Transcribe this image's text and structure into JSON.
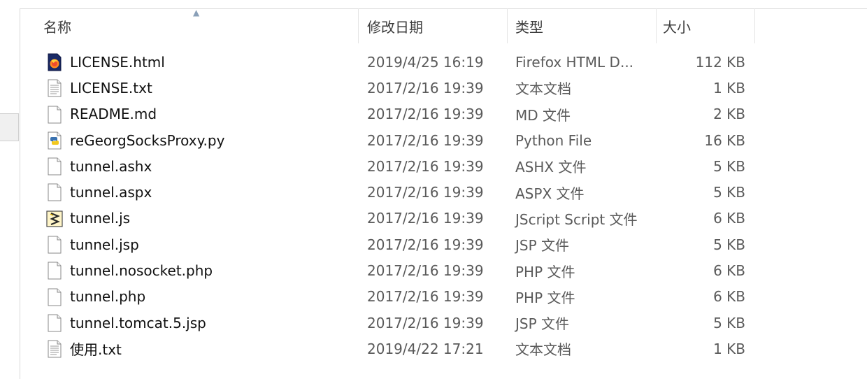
{
  "columns": {
    "name": "名称",
    "date": "修改日期",
    "type": "类型",
    "size": "大小"
  },
  "icons": {
    "html": "firefox-html-file-icon",
    "text": "text-document-icon",
    "blank": "generic-file-icon",
    "python": "python-file-icon",
    "js": "jscript-file-icon"
  },
  "files": [
    {
      "name": "LICENSE.html",
      "date": "2019/4/25 16:19",
      "type": "Firefox HTML D...",
      "size": "112 KB",
      "icon": "html"
    },
    {
      "name": "LICENSE.txt",
      "date": "2017/2/16 19:39",
      "type": "文本文档",
      "size": "1 KB",
      "icon": "text"
    },
    {
      "name": "README.md",
      "date": "2017/2/16 19:39",
      "type": "MD 文件",
      "size": "2 KB",
      "icon": "blank"
    },
    {
      "name": "reGeorgSocksProxy.py",
      "date": "2017/2/16 19:39",
      "type": "Python File",
      "size": "16 KB",
      "icon": "python"
    },
    {
      "name": "tunnel.ashx",
      "date": "2017/2/16 19:39",
      "type": "ASHX 文件",
      "size": "5 KB",
      "icon": "blank"
    },
    {
      "name": "tunnel.aspx",
      "date": "2017/2/16 19:39",
      "type": "ASPX 文件",
      "size": "5 KB",
      "icon": "blank"
    },
    {
      "name": "tunnel.js",
      "date": "2017/2/16 19:39",
      "type": "JScript Script 文件",
      "size": "6 KB",
      "icon": "js"
    },
    {
      "name": "tunnel.jsp",
      "date": "2017/2/16 19:39",
      "type": "JSP 文件",
      "size": "5 KB",
      "icon": "blank"
    },
    {
      "name": "tunnel.nosocket.php",
      "date": "2017/2/16 19:39",
      "type": "PHP 文件",
      "size": "6 KB",
      "icon": "blank"
    },
    {
      "name": "tunnel.php",
      "date": "2017/2/16 19:39",
      "type": "PHP 文件",
      "size": "6 KB",
      "icon": "blank"
    },
    {
      "name": "tunnel.tomcat.5.jsp",
      "date": "2017/2/16 19:39",
      "type": "JSP 文件",
      "size": "5 KB",
      "icon": "blank"
    },
    {
      "name": "使用.txt",
      "date": "2019/4/22 17:21",
      "type": "文本文档",
      "size": "1 KB",
      "icon": "text"
    }
  ]
}
